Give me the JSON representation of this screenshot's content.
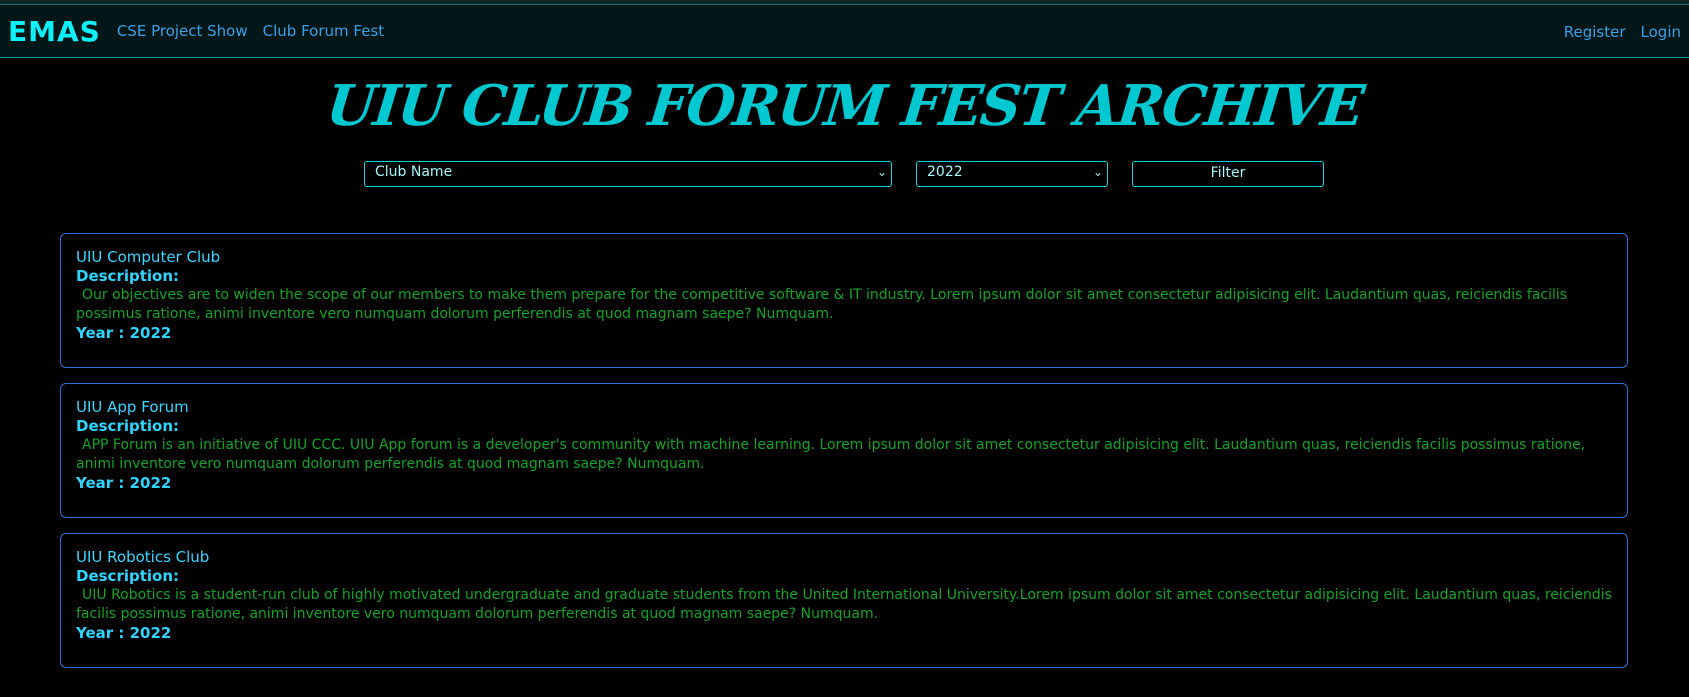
{
  "navbar": {
    "brand": "EMAS",
    "links": [
      "CSE Project Show",
      "Club Forum Fest"
    ],
    "right_links": [
      "Register",
      "Login"
    ]
  },
  "page_title": "UIU CLUB FORUM FEST ARCHIVE",
  "filters": {
    "club_select_value": "Club Name",
    "year_select_value": "2022",
    "filter_button": "Filter"
  },
  "labels": {
    "description": "Description:",
    "year_prefix": "Year : "
  },
  "cards": [
    {
      "name": "UIU Computer Club",
      "description": "Our objectives are to widen the scope of our members to make them prepare for the competitive software & IT industry. Lorem ipsum dolor sit amet consectetur adipisicing elit. Laudantium quas, reiciendis facilis possimus ratione, animi inventore vero numquam dolorum perferendis at quod magnam saepe? Numquam.",
      "year": "Year : 2022"
    },
    {
      "name": "UIU App Forum",
      "description": "APP Forum is an initiative of UIU CCC. UIU App forum is a developer's community with machine learning. Lorem ipsum dolor sit amet consectetur adipisicing elit. Laudantium quas, reiciendis facilis possimus ratione, animi inventore vero numquam dolorum perferendis at quod magnam saepe? Numquam.",
      "year": "Year : 2022"
    },
    {
      "name": "UIU Robotics Club",
      "description": "UIU Robotics is a student-run club of highly motivated undergraduate and graduate students from the United International University.Lorem ipsum dolor sit amet consectetur adipisicing elit. Laudantium quas, reiciendis facilis possimus ratione, animi inventore vero numquam dolorum perferendis at quod magnam saepe? Numquam.",
      "year": "Year : 2022"
    }
  ]
}
